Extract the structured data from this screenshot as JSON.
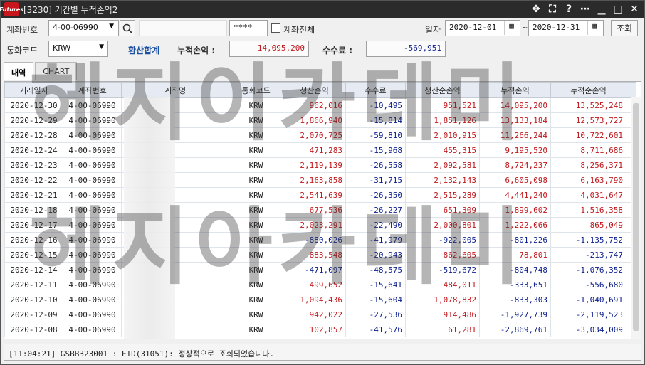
{
  "window": {
    "title": "[3230] 기간별 누적손익2",
    "logo_text": "Futures",
    "icons": [
      "move-icon",
      "expand-icon",
      "help-icon",
      "more-icon",
      "minimize-icon",
      "maximize-icon",
      "close-icon"
    ]
  },
  "filters": {
    "account_label": "계좌번호",
    "account_value": "4-00-06990",
    "password_value": "****",
    "all_accounts_label": "계좌전체",
    "date_label": "일자",
    "date_from": "2020-12-01",
    "date_to": "2020-12-31",
    "range_sep": "~",
    "search_button": "조회",
    "currency_label": "통화코드",
    "currency_value": "KRW",
    "convert_total": "환산합계",
    "cum_pnl_label": "누적손익 :",
    "cum_pnl_value": "14,095,200",
    "fee_label": "수수료 :",
    "fee_value": "-569,951"
  },
  "tabs": [
    {
      "label": "내역"
    },
    {
      "label": "CHART"
    }
  ],
  "table": {
    "headers": [
      "거래일자",
      "계좌번호",
      "계좌명",
      "통화코드",
      "청산손익",
      "수수료",
      "청산순손익",
      "누적손익",
      "누적순손익"
    ],
    "rows": [
      [
        "2020-12-30",
        "4-00-06990",
        "",
        "KRW",
        "962,016",
        "-10,495",
        "951,521",
        "14,095,200",
        "13,525,248"
      ],
      [
        "2020-12-29",
        "4-00-06990",
        "",
        "KRW",
        "1,866,940",
        "-15,814",
        "1,851,126",
        "13,133,184",
        "12,573,727"
      ],
      [
        "2020-12-28",
        "4-00-06990",
        "",
        "KRW",
        "2,070,725",
        "-59,810",
        "2,010,915",
        "11,266,244",
        "10,722,601"
      ],
      [
        "2020-12-24",
        "4-00-06990",
        "",
        "KRW",
        "471,283",
        "-15,968",
        "455,315",
        "9,195,520",
        "8,711,686"
      ],
      [
        "2020-12-23",
        "4-00-06990",
        "",
        "KRW",
        "2,119,139",
        "-26,558",
        "2,092,581",
        "8,724,237",
        "8,256,371"
      ],
      [
        "2020-12-22",
        "4-00-06990",
        "",
        "KRW",
        "2,163,858",
        "-31,715",
        "2,132,143",
        "6,605,098",
        "6,163,790"
      ],
      [
        "2020-12-21",
        "4-00-06990",
        "",
        "KRW",
        "2,541,639",
        "-26,350",
        "2,515,289",
        "4,441,240",
        "4,031,647"
      ],
      [
        "2020-12-18",
        "4-00-06990",
        "",
        "KRW",
        "677,536",
        "-26,227",
        "651,309",
        "1,899,602",
        "1,516,358"
      ],
      [
        "2020-12-17",
        "4-00-06990",
        "",
        "KRW",
        "2,023,291",
        "-22,490",
        "2,000,801",
        "1,222,066",
        "865,049"
      ],
      [
        "2020-12-16",
        "4-00-06990",
        "",
        "KRW",
        "-880,026",
        "-41,979",
        "-922,005",
        "-801,226",
        "-1,135,752"
      ],
      [
        "2020-12-15",
        "4-00-06990",
        "",
        "KRW",
        "883,548",
        "-20,943",
        "862,605",
        "78,801",
        "-213,747"
      ],
      [
        "2020-12-14",
        "4-00-06990",
        "",
        "KRW",
        "-471,097",
        "-48,575",
        "-519,672",
        "-804,748",
        "-1,076,352"
      ],
      [
        "2020-12-11",
        "4-00-06990",
        "",
        "KRW",
        "499,652",
        "-15,641",
        "484,011",
        "-333,651",
        "-556,680"
      ],
      [
        "2020-12-10",
        "4-00-06990",
        "",
        "KRW",
        "1,094,436",
        "-15,604",
        "1,078,832",
        "-833,303",
        "-1,040,691"
      ],
      [
        "2020-12-09",
        "4-00-06990",
        "",
        "KRW",
        "942,022",
        "-27,536",
        "914,486",
        "-1,927,739",
        "-2,119,523"
      ],
      [
        "2020-12-08",
        "4-00-06990",
        "",
        "KRW",
        "102,857",
        "-41,576",
        "61,281",
        "-2,869,761",
        "-3,034,009"
      ]
    ]
  },
  "status": "[11:04:21] GSBB323001 : EID(31051): 정상적으로 조회되었습니다.",
  "watermark": [
    "헤지이카데미",
    "헤지아카데미"
  ],
  "colors": {
    "positive": "#c0181c",
    "negative": "#0a1d8c",
    "accent": "#1a4fa0"
  }
}
